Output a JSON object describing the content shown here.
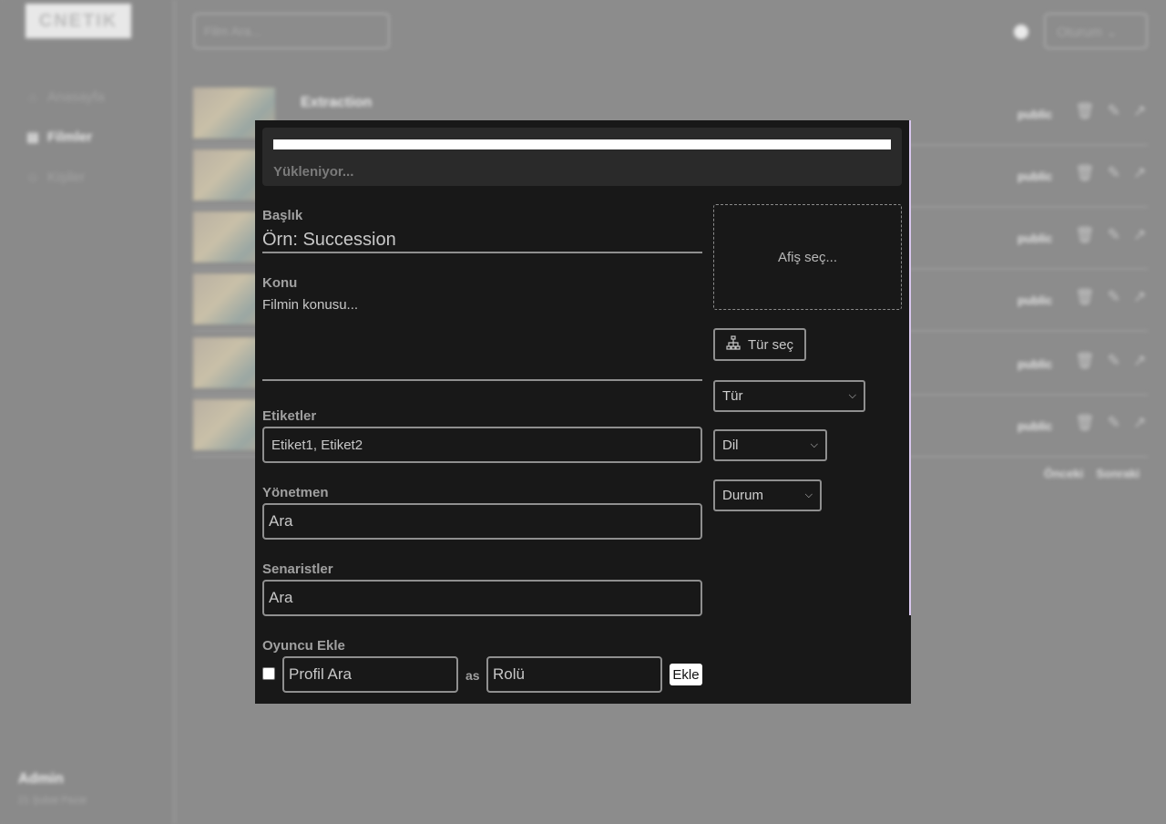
{
  "background": {
    "logo": "CNETIK",
    "nav": [
      {
        "icon": "home-icon",
        "glyph": "⌂",
        "label": "Anasayfa"
      },
      {
        "icon": "film-icon",
        "glyph": "▤",
        "label": "Filmler"
      },
      {
        "icon": "person-icon",
        "glyph": "☺",
        "label": "Kişiler"
      }
    ],
    "admin_name": "Admin",
    "admin_sub": "21 Şubat Pazar",
    "search_placeholder": "Film Ara...",
    "user_menu": "Oturum",
    "rows": [
      {
        "title": "Extraction",
        "status": "public"
      },
      {
        "title": "",
        "status": "public"
      },
      {
        "title": "",
        "status": "public"
      },
      {
        "title": "",
        "status": "public"
      },
      {
        "title": "",
        "status": "public"
      },
      {
        "title": "",
        "status": "public"
      }
    ],
    "pager": [
      "Önceki",
      "Sonraki"
    ]
  },
  "upload": {
    "progress": 1.0,
    "status_text": "Yükleniyor..."
  },
  "form": {
    "title_label": "Başlık",
    "title_placeholder": "Örn: Succession",
    "plot_label": "Konu",
    "plot_placeholder": "Filmin konusu...",
    "tags_label": "Etiketler",
    "tags_placeholder": "Etiket1, Etiket2",
    "director_label": "Yönetmen",
    "director_placeholder": "Ara",
    "writers_label": "Senaristler",
    "writers_placeholder": "Ara",
    "cast_label": "Oyuncu Ekle",
    "profile_placeholder": "Profil Ara",
    "as_text": "as",
    "role_placeholder": "Rolü",
    "add_button": "Ekle"
  },
  "side": {
    "poster_label": "Afiş seç...",
    "genre_button": "Tür seç",
    "genre_select": "Tür",
    "language_select": "Dil",
    "status_select": "Durum"
  }
}
